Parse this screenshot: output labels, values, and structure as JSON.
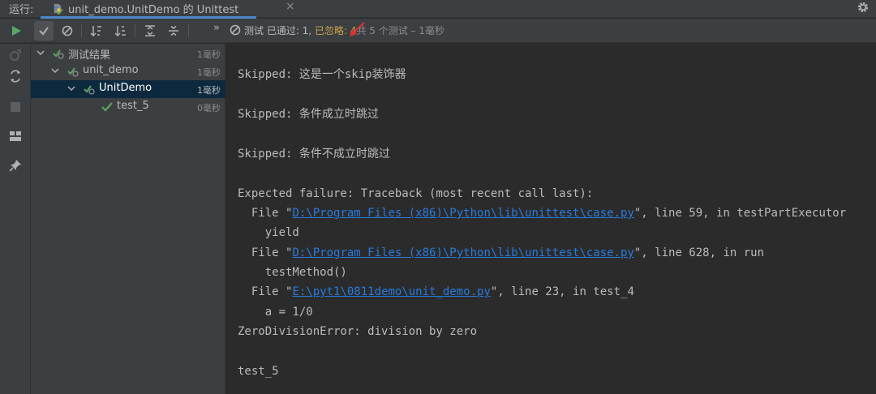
{
  "tabbar": {
    "run_label": "运行:",
    "tab_title": "unit_demo.UnitDemo 的 Unittest",
    "close_glyph": "×",
    "accent": "#4a88c7"
  },
  "toolbar": {
    "overflow": "»",
    "status_prefix": "测试 已通过: 1, ",
    "status_ignored": "已忽略: 4",
    "status_rest": "共 5 个测试 – 1毫秒",
    "ignored_color": "#c7a44d"
  },
  "tree": {
    "rows": [
      {
        "label": "测试结果",
        "time": "1毫秒"
      },
      {
        "label": "unit_demo",
        "time": "1毫秒"
      },
      {
        "label": "UnitDemo",
        "time": "1毫秒"
      },
      {
        "label": "test_5",
        "time": "0毫秒"
      }
    ]
  },
  "console": {
    "lines": [
      {
        "pre": "Skipped: 这是一个skip装饰器"
      },
      {
        "pre": "Skipped: 条件成立时跳过"
      },
      {
        "pre": "Skipped: 条件不成立时跳过"
      },
      {
        "pre": "Expected failure: Traceback (most recent call last):"
      },
      {
        "pre": "  File \"",
        "link": "D:\\Program Files (x86)\\Python\\lib\\unittest\\case.py",
        "post": "\", line 59, in testPartExecutor"
      },
      {
        "pre": "    yield"
      },
      {
        "pre": "  File \"",
        "link": "D:\\Program Files (x86)\\Python\\lib\\unittest\\case.py",
        "post": "\", line 628, in run"
      },
      {
        "pre": "    testMethod()"
      },
      {
        "pre": "  File \"",
        "link": "E:\\pyt1\\0811demo\\unit_demo.py",
        "post": "\", line 23, in test_4"
      },
      {
        "pre": "    a = 1/0"
      },
      {
        "pre": "ZeroDivisionError: division by zero"
      },
      {
        "pre": "test_5"
      }
    ],
    "link_color": "#287bde"
  }
}
